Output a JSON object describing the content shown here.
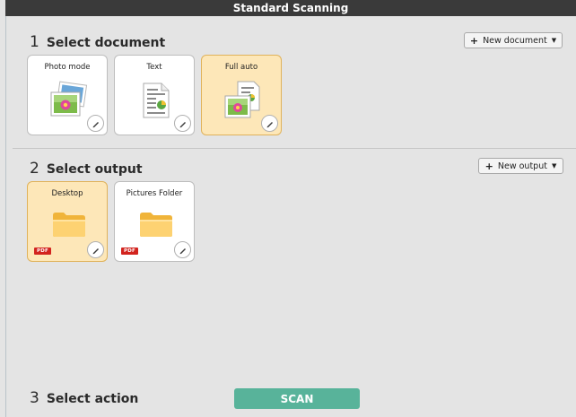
{
  "window": {
    "title": "Standard Scanning"
  },
  "sections": {
    "document": {
      "number": "1",
      "label": "Select document",
      "new_button": "New document"
    },
    "output": {
      "number": "2",
      "label": "Select output",
      "new_button": "New output"
    },
    "action": {
      "number": "3",
      "label": "Select action",
      "scan_button": "SCAN"
    }
  },
  "documents": [
    {
      "label": "Photo mode",
      "icon": "photo-mode-icon",
      "selected": false
    },
    {
      "label": "Text",
      "icon": "text-document-icon",
      "selected": false
    },
    {
      "label": "Full auto",
      "icon": "full-auto-icon",
      "selected": true
    }
  ],
  "outputs": [
    {
      "label": "Desktop",
      "format": "PDF",
      "icon": "folder-icon",
      "selected": true
    },
    {
      "label": "Pictures Folder",
      "format": "PDF",
      "icon": "folder-icon",
      "selected": false
    }
  ],
  "colors": {
    "titlebar": "#3a3a3a",
    "selected_card": "#fde7b8",
    "scan_button": "#58b39a",
    "pdf_badge": "#d2231e"
  }
}
